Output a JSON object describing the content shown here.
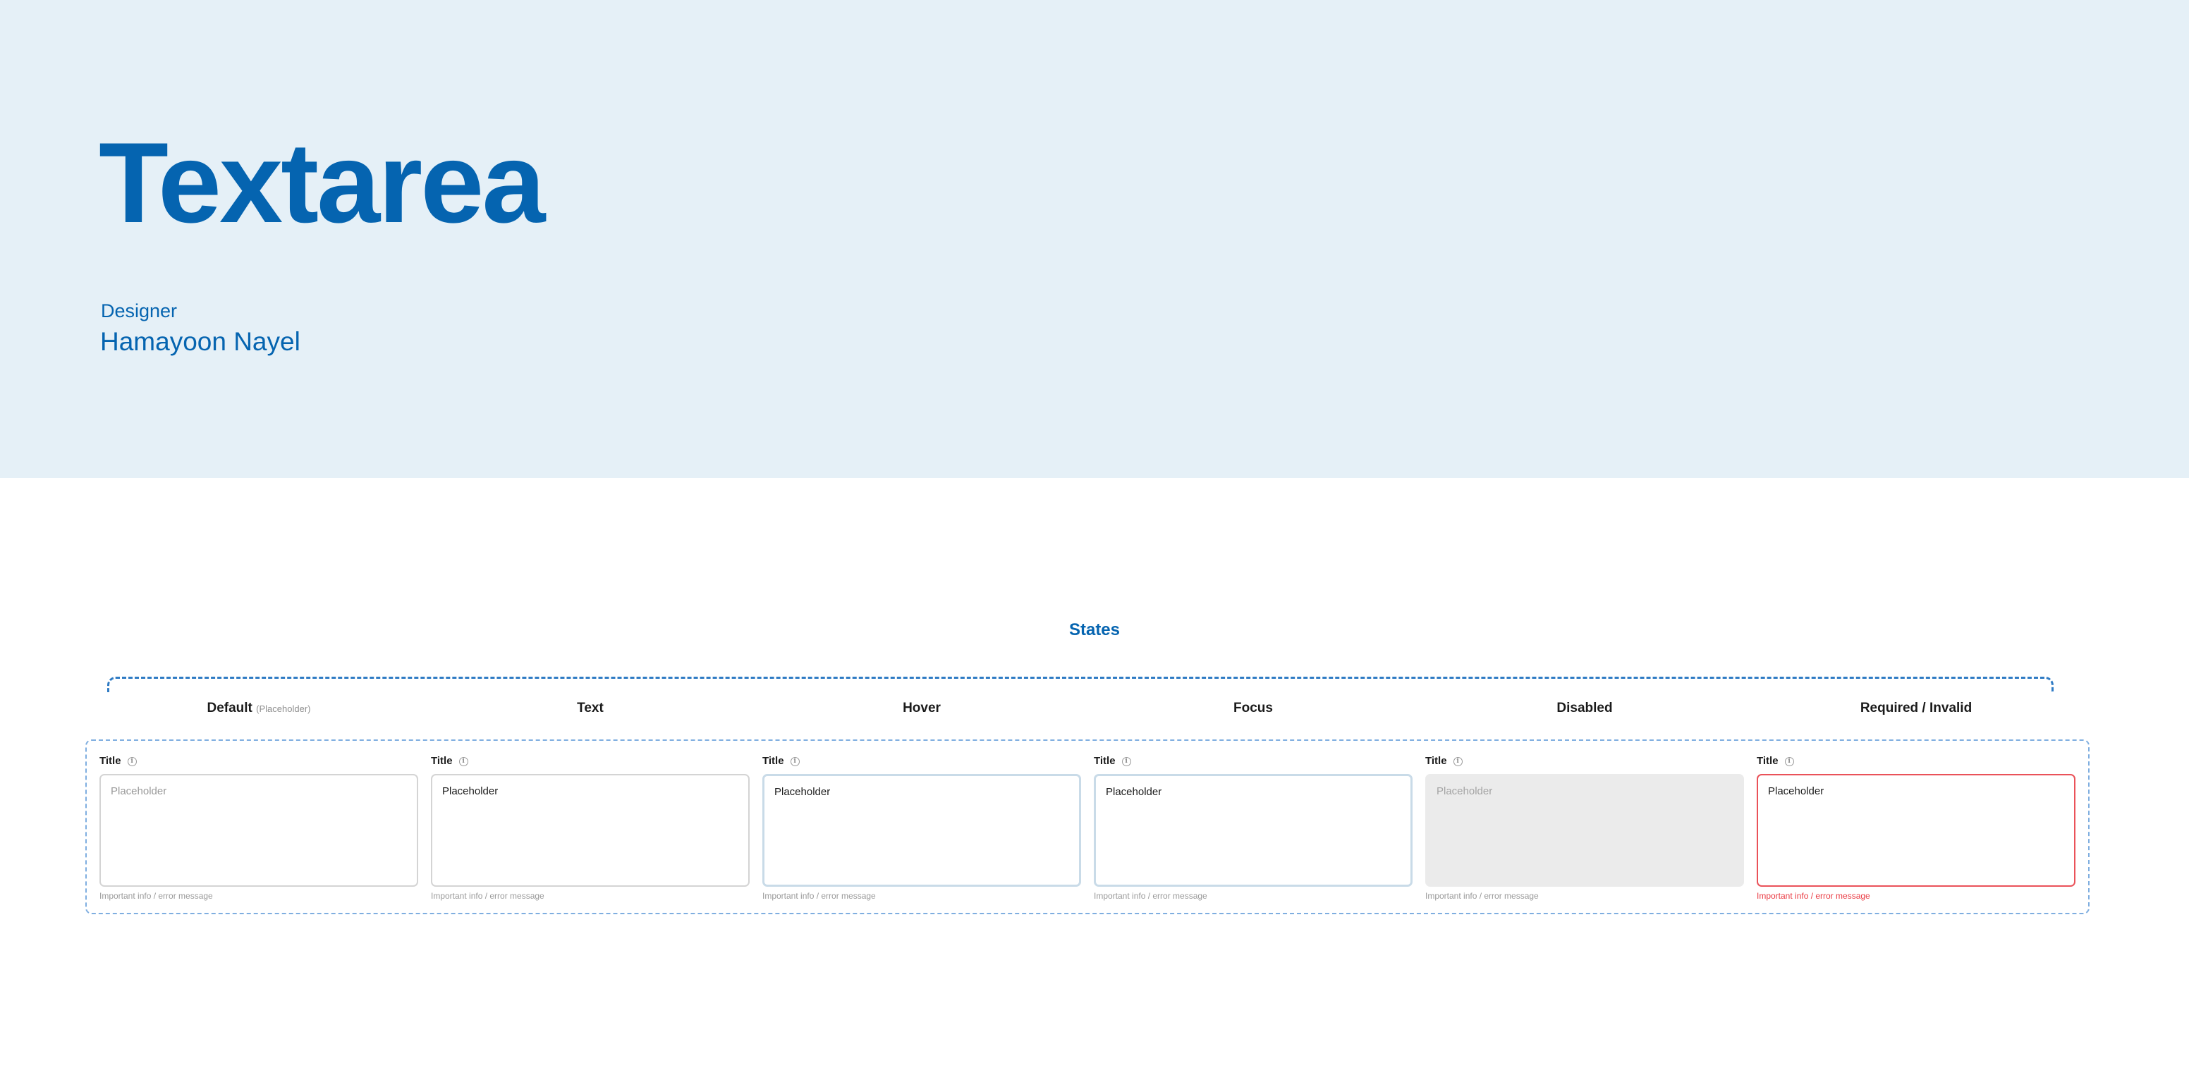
{
  "header": {
    "title": "Textarea",
    "designer_label": "Designer",
    "designer_name": "Hamayoon Nayel"
  },
  "states_section": {
    "title": "States",
    "columns": [
      {
        "label": "Default",
        "sublabel": "(Placeholder)"
      },
      {
        "label": "Text"
      },
      {
        "label": "Hover"
      },
      {
        "label": "Focus"
      },
      {
        "label": "Disabled"
      },
      {
        "label": "Required / Invalid"
      }
    ],
    "fields": [
      {
        "state": "default",
        "title": "Title",
        "placeholder": "Placeholder",
        "helper": "Important info / error message"
      },
      {
        "state": "text",
        "title": "Title",
        "value": "Placeholder",
        "helper": "Important info / error message"
      },
      {
        "state": "hover",
        "title": "Title",
        "value": "Placeholder",
        "helper": "Important info / error message"
      },
      {
        "state": "focus",
        "title": "Title",
        "value": "Placeholder",
        "helper": "Important info / error message"
      },
      {
        "state": "disabled",
        "title": "Title",
        "placeholder": "Placeholder",
        "helper": "Important info / error message"
      },
      {
        "state": "invalid",
        "title": "Title",
        "value": "Placeholder",
        "helper": "Important info / error message"
      }
    ]
  },
  "icons": {
    "info": "info-icon"
  },
  "colors": {
    "hero_background": "#e5f0f7",
    "brand_blue": "#0564b0",
    "frame_dash": "#7faee0",
    "error_red": "#ea3b43",
    "disabled_fill": "#ebebeb"
  }
}
